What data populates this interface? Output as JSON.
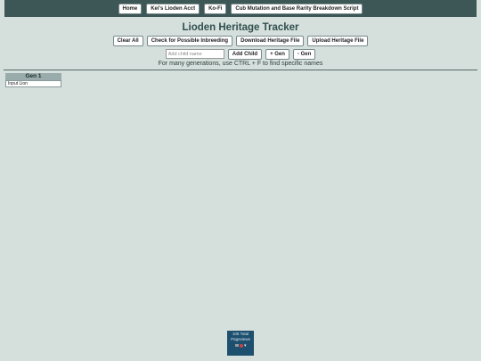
{
  "nav": {
    "items": [
      {
        "label": "Home"
      },
      {
        "label": "Kei's Lioden Acct"
      },
      {
        "label": "Ko-Fi"
      },
      {
        "label": "Cub Mutation and Base Rarity Breakdown Script"
      }
    ]
  },
  "page": {
    "title": "Lioden Heritage Tracker",
    "hint": "For many generations, use CTRL + F to find specific names"
  },
  "actions": {
    "clear_all": "Clear All",
    "check_inbreeding": "Check for Possible Inbreeding",
    "download": "Download Heritage File",
    "upload": "Upload Heritage File"
  },
  "child": {
    "placeholder": "Add child name",
    "add_child": "Add Child",
    "add_gen": "+ Gen",
    "remove_gen": "- Gen"
  },
  "generations": [
    {
      "header": "Gen 1",
      "cells": [
        "Input Lion"
      ]
    }
  ],
  "counter": {
    "line1": "105 Total",
    "line2": "Pageviews"
  }
}
